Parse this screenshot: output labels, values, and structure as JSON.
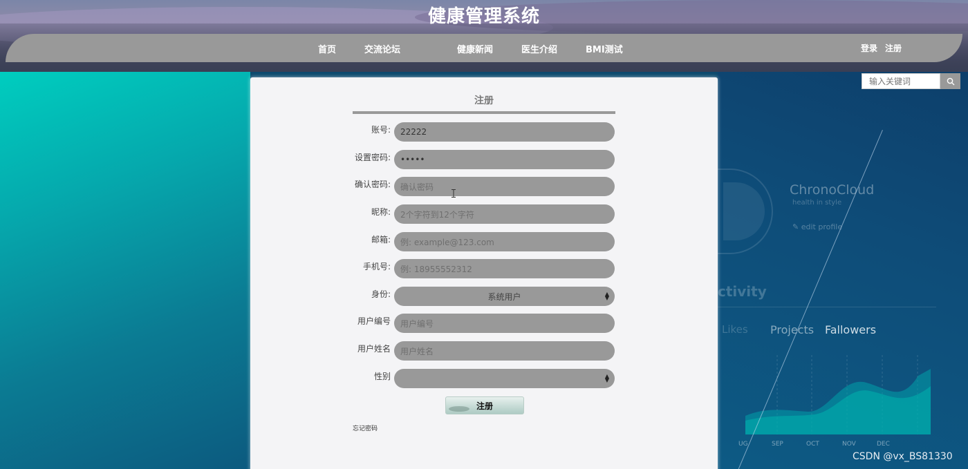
{
  "header": {
    "title": "健康管理系统",
    "nav": [
      "首页",
      "交流论坛",
      "健康新闻",
      "医生介绍",
      "BMI测试"
    ],
    "auth": [
      "登录",
      "注册"
    ]
  },
  "search": {
    "placeholder": "输入关键词"
  },
  "form": {
    "title": "注册",
    "fields": [
      {
        "label": "账号:",
        "value": "22222"
      },
      {
        "label": "设置密码:",
        "value": "•••••"
      },
      {
        "label": "确认密码:",
        "placeholder": "确认密码"
      },
      {
        "label": "昵称:",
        "placeholder": "2个字符到12个字符"
      },
      {
        "label": "邮箱:",
        "placeholder": "例: example@123.com"
      },
      {
        "label": "手机号:",
        "placeholder": "例: 18955552312"
      },
      {
        "label": "身份:",
        "selected": "系统用户"
      },
      {
        "label": "用户编号",
        "placeholder": "用户编号"
      },
      {
        "label": "用户姓名",
        "placeholder": "用户姓名"
      },
      {
        "label": "性别",
        "selected": ""
      }
    ],
    "submit_label": "注册",
    "forgot_label": "忘记密码"
  },
  "background": {
    "brand": "ChronoCloud",
    "tagline": "health in style",
    "edit": "edit profile",
    "activity": "ctivity",
    "tabs": [
      "Likes",
      "Projects",
      "Fallowers"
    ],
    "months": [
      "UG",
      "SEP",
      "OCT",
      "NOV",
      "DEC"
    ]
  },
  "watermark": "CSDN @vx_BS81330",
  "colors": {
    "nav": "#999999",
    "field": "#999999",
    "panel": "#f4f4f6",
    "teal": "#00cdbf"
  }
}
